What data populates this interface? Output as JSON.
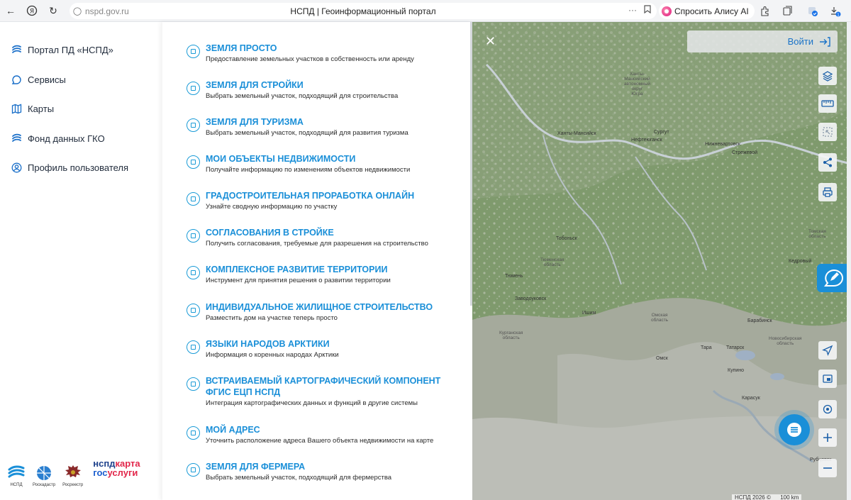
{
  "browser": {
    "url": "nspd.gov.ru",
    "page_title": "НСПД | Геоинформационный портал",
    "alice_label": "Спросить Алису AI"
  },
  "sidebar": {
    "items": [
      {
        "label": "Портал ПД «НСПД»",
        "icon": "nspd-logo-icon"
      },
      {
        "label": "Сервисы",
        "icon": "chat-bubble-icon"
      },
      {
        "label": "Карты",
        "icon": "map-icon"
      },
      {
        "label": "Фонд данных ГКО",
        "icon": "nspd-logo-icon"
      },
      {
        "label": "Профиль пользователя",
        "icon": "user-circle-icon"
      }
    ],
    "logos": {
      "nspd_caption": "НСПД",
      "roskadastr_caption": "Роскадастр",
      "rosreestr_caption": "Росреестр",
      "brand_line1_a": "нспд",
      "brand_line1_b": "карта",
      "brand_line2_a": "гос",
      "brand_line2_b": "услуги"
    }
  },
  "services": [
    {
      "title": "ЗЕМЛЯ ПРОСТО",
      "desc": "Предоставление земельных участков в собственность или аренду"
    },
    {
      "title": "ЗЕМЛЯ ДЛЯ СТРОЙКИ",
      "desc": "Выбрать земельный участок, подходящий для строительства"
    },
    {
      "title": "ЗЕМЛЯ ДЛЯ ТУРИЗМА",
      "desc": "Выбрать земельный участок, подходящий для развития туризма"
    },
    {
      "title": "МОИ ОБЪЕКТЫ НЕДВИЖИМОСТИ",
      "desc": "Получайте информацию по изменениям объектов недвижимости"
    },
    {
      "title": "ГРАДОСТРОИТЕЛЬНАЯ ПРОРАБОТКА ОНЛАЙН",
      "desc": "Узнайте сводную информацию по участку"
    },
    {
      "title": "СОГЛАСОВАНИЯ В СТРОЙКЕ",
      "desc": "Получить согласования, требуемые для разрешения на строительство"
    },
    {
      "title": "КОМПЛЕКСНОЕ РАЗВИТИЕ ТЕРРИТОРИИ",
      "desc": "Инструмент для принятия решения о развитии территории"
    },
    {
      "title": "ИНДИВИДУАЛЬНОЕ ЖИЛИЩНОЕ СТРОИТЕЛЬСТВО",
      "desc": "Разместить дом на участке теперь просто"
    },
    {
      "title": "ЯЗЫКИ НАРОДОВ АРКТИКИ",
      "desc": "Информация о коренных народах Арктики"
    },
    {
      "title": "ВСТРАИВАЕМЫЙ КАРТОГРАФИЧЕСКИЙ КОМПОНЕНТ",
      "title2": "ФГИС ЕЦП НСПД",
      "desc": "Интеграция картографических данных и функций в другие системы"
    },
    {
      "title": "МОЙ АДРЕС",
      "desc": "Уточнить расположение адреса Вашего объекта недвижимости на карте"
    },
    {
      "title": "ЗЕМЛЯ ДЛЯ ФЕРМЕРА",
      "desc": "Выбрать земельный участок, подходящий для фермерства"
    }
  ],
  "map": {
    "login_label": "Войти",
    "scale_label": "НСПД 2026 ©",
    "scale_distance": "100 km",
    "labels": {
      "hmao": "Ханты-\nМансийский\nавтономный\nокруг\nЮгра",
      "khanty_mansiysk": "Ханты-Мансийск",
      "surgut": "Сургут",
      "nefteyugansk": "Нефтеюганск",
      "nizhnevartovsk": "Нижневартовск",
      "strezhevoy": "Стрежевой",
      "tobolsk": "Тобольск",
      "tyumen_obl": "Тюменская\nобласть",
      "tyumen": "Тюмень",
      "zavodoukovsk": "Заводоуковск",
      "ishim": "Ишим",
      "omsk_obl": "Омская\nобласть",
      "kurgan_obl": "Курганская\nобласть",
      "tara": "Тара",
      "omsk": "Омск",
      "tomsk_obl": "Томская\nобласть",
      "kedrovy": "Кедровый",
      "barabinsk": "Барабинск",
      "novosib_obl": "Новосибирская\nобласть",
      "tatarsk": "Татарск",
      "kupino": "Купино",
      "karasuk": "Карасук",
      "rubtsovsk": "Рубцовск"
    }
  }
}
